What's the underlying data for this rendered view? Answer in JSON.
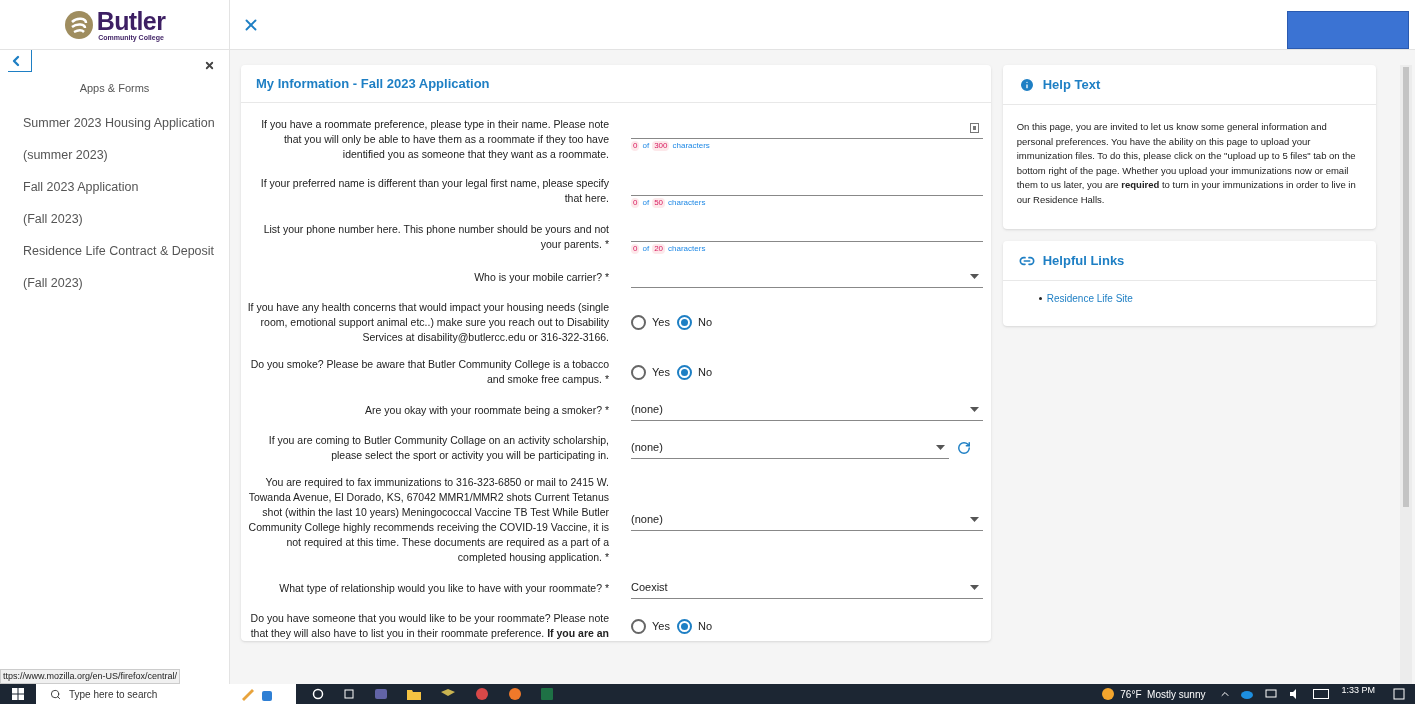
{
  "logo": {
    "name": "Butler",
    "subtitle": "Community College"
  },
  "sidebar": {
    "heading": "Apps & Forms",
    "items": [
      {
        "title": "Summer 2023 Housing Application",
        "term": "(summer 2023)"
      },
      {
        "title": "Fall 2023 Application",
        "term": "(Fall 2023)"
      },
      {
        "title": "Residence Life Contract & Deposit",
        "term": "(Fall 2023)"
      }
    ]
  },
  "form": {
    "title": "My Information - Fall 2023 Application",
    "fields": [
      {
        "kind": "text",
        "label": "If you have a roommate preference, please type in their name. Please note that you will only be able to have them as a roommate if they too have identified you as someone that they want as a roommate.",
        "counter": {
          "count": "0",
          "of": "of",
          "max": "300",
          "unit": "characters"
        },
        "has_icon": true
      },
      {
        "kind": "text",
        "label": "If your preferred name is different than your legal first name, please specify that here.",
        "counter": {
          "count": "0",
          "of": "of",
          "max": "50",
          "unit": "characters"
        },
        "has_icon": false
      },
      {
        "kind": "text",
        "label": "List your phone number here. This phone number should be yours and not your parents. *",
        "counter": {
          "count": "0",
          "of": "of",
          "max": "20",
          "unit": "characters"
        },
        "has_icon": false
      },
      {
        "kind": "select",
        "label": "Who is your mobile carrier? *",
        "refresh": false
      },
      {
        "kind": "radio",
        "label": "If you have any health concerns that would impact your housing needs (single room, emotional support animal etc..) make sure you reach out to Disability Services at disability@butlercc.edu or 316-322-3166.",
        "options": [
          {
            "label": "Yes",
            "selected": false
          },
          {
            "label": "No",
            "selected": true
          }
        ]
      },
      {
        "kind": "radio",
        "label": "Do you smoke? Please be aware that Butler Community College is a tobacco and smoke free campus. *",
        "options": [
          {
            "label": "Yes",
            "selected": false
          },
          {
            "label": "No",
            "selected": true
          }
        ]
      },
      {
        "kind": "select",
        "label": "Are you okay with your roommate being a smoker? *",
        "value": "(none)",
        "refresh": false
      },
      {
        "kind": "select",
        "label": "If you are coming to Butler Community Collage on an activity scholarship, please select the sport or activity you will be participating in.",
        "value": "(none)",
        "refresh": true
      },
      {
        "kind": "select",
        "label": "You are required to fax immunizations to 316-323-6850 or mail to 2415 W. Towanda Avenue, El Dorado, KS, 67042 MMR1/MMR2 shots Current Tetanus shot (within the last 10 years) Meningococcal Vaccine TB Test While Butler Community College highly recommends receiving the COVID-19 Vaccine, it is not required at this time. These documents are required as a part of a completed housing application. *",
        "value": "(none)",
        "refresh": false
      },
      {
        "kind": "select",
        "label": "What type of relationship would you like to have with your roommate? *",
        "value": "Coexist",
        "refresh": false
      },
      {
        "kind": "radio",
        "label": "Do you have someone that you would like to be your roommate? Please note that they will also have to list you in their roommate preference. **If you are an**",
        "options": [
          {
            "label": "Yes",
            "selected": false
          },
          {
            "label": "No",
            "selected": true
          }
        ]
      }
    ]
  },
  "help": {
    "title": "Help Text",
    "body": "On this page, you are invited to let us know some general information and personal preferences. You have the ability on this page to upload your immunization files. To do this, please click on the \"upload up to 5 files\" tab on the bottom right of the page. Whether you upload your immunizations now or email them to us later, you are **required** to turn in your immunizations in order to live in our Residence Halls."
  },
  "links": {
    "title": "Helpful Links",
    "items": [
      "Residence Life Site"
    ]
  },
  "status_url": "ttps://www.mozilla.org/en-US/firefox/central/",
  "taskbar": {
    "search": "Type here to search",
    "weather": "76°F  Mostly sunny",
    "time": "1:33 PM"
  }
}
